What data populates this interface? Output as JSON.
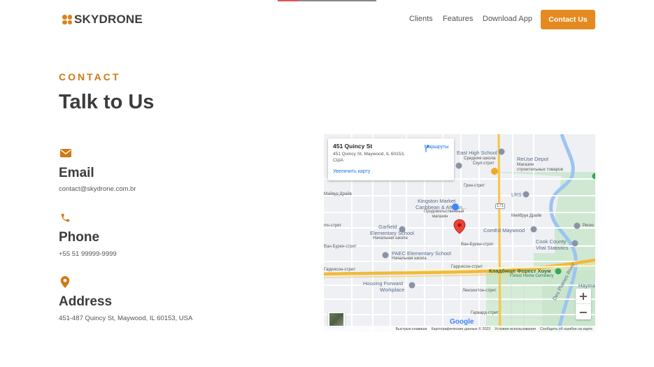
{
  "header": {
    "logo_text": "SKYDRONE",
    "nav": [
      {
        "label": "Clients"
      },
      {
        "label": "Features"
      },
      {
        "label": "Download App"
      }
    ],
    "cta_label": "Contact Us"
  },
  "section": {
    "eyebrow": "CONTACT",
    "title": "Talk to Us"
  },
  "contact": {
    "email": {
      "title": "Email",
      "value": "contact@skydrone.com.br",
      "icon": "envelope-icon"
    },
    "phone": {
      "title": "Phone",
      "value": "+55 51 99999-9999",
      "icon": "phone-icon"
    },
    "address": {
      "title": "Address",
      "value": "451-487 Quincy St, Maywood, IL 60153, USA",
      "icon": "map-pin-icon"
    }
  },
  "map": {
    "card": {
      "title": "451 Quincy St",
      "address": "451 Quincy St, Maywood, IL 60153, США",
      "enlarge_link": "Увеличить карту",
      "directions_label": "Маршруты"
    },
    "labels": {
      "east_high": "East High School",
      "east_high_sub": "Средняя школа",
      "reuse": "ReUse Depot",
      "reuse_sub1": "Магазин",
      "reuse_sub2": "строительных товаров",
      "skup": "Скуп-стрит",
      "grin": "Грин-стрит",
      "maiwud": "Мэйвуд Драйв",
      "kingston": "Kingston Market",
      "kingston2": "Caribbean & African...",
      "kingston_sub1": "Продовольственный",
      "kingston_sub2": "магазин",
      "lrs": "LRS",
      "meiburk": "Мейбрук Драйв",
      "garfield": "Garfield",
      "garfield2": "Elementary School",
      "garfield_sub": "Начальная школа",
      "comed": "ComEd Maywood",
      "vanburen": "Ван-Бурен-стрит",
      "vanburen2": "Ван-Бурен-стрит",
      "cook": "Cook County",
      "cook2": "Vital Statistics",
      "paec": "PAEC Elementary School",
      "paec_sub": "Начальная школа",
      "garrison": "Гаррисон-стрит",
      "garrison2": "Гаррисон-стрит",
      "cemetery": "Кладбище Форест Хоум",
      "cemetery_sub": "Forest Home Cemetery",
      "housing": "Housing Forward",
      "housing2": "Workplace",
      "lexington": "Лексингтон-стрит",
      "harvard": "Гарвард-стрит",
      "desplaines": "Des Plaines River",
      "haym": "Hayma",
      "ms": "ms-стрит",
      "route": "171",
      "rs": "Регио"
    },
    "zoom_in": "+",
    "zoom_out": "−",
    "google": "Google",
    "attribution": [
      "Быстрые клавиши",
      "Картографические данные © 2023",
      "Условия использования",
      "Сообщить об ошибке на карте"
    ]
  }
}
